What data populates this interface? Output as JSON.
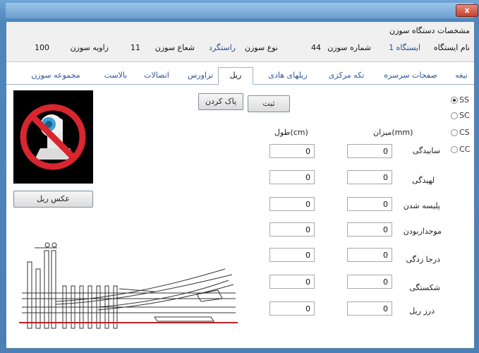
{
  "window": {
    "close_label": "x"
  },
  "info": {
    "header": "مشخصات دستگاه سوزن",
    "station_label": "نام ایستگاه",
    "station_value": "ایستگاه 1",
    "switch_number_label": "شماره سوزن",
    "switch_number_value": "44",
    "switch_type_label": "نوع سوزن",
    "switch_type_value": "راستگرد",
    "radius_label": "شعاع سوزن",
    "radius_value": "11",
    "angle_label": "زاویه سوزن",
    "angle_value": "100"
  },
  "tabs": [
    {
      "label": "تیغه"
    },
    {
      "label": "صفحات سرسره"
    },
    {
      "label": "تکه مرکزی"
    },
    {
      "label": "ریلهای هادی"
    },
    {
      "label": "ریل"
    },
    {
      "label": "تراورس"
    },
    {
      "label": "اتصالات"
    },
    {
      "label": "بالاست"
    },
    {
      "label": "مجموعه سوزن"
    }
  ],
  "active_tab": "ریل",
  "buttons": {
    "save": "ثبت",
    "clear": "پاک کردن",
    "rail_photo": "عکس ریل"
  },
  "radios": [
    {
      "label": "SS",
      "checked": true
    },
    {
      "label": "SC",
      "checked": false
    },
    {
      "label": "CS",
      "checked": false
    },
    {
      "label": "CC",
      "checked": false
    }
  ],
  "columns": {
    "amount": "میزان(mm)",
    "length": "طول(cm)"
  },
  "rows": [
    {
      "label": "سابیدگی",
      "amount": "0",
      "length": "0"
    },
    {
      "label": "لهیدگی",
      "amount": "0",
      "length": "0"
    },
    {
      "label": "پلیسه شدن",
      "amount": "0",
      "length": "0"
    },
    {
      "label": "موجداربودن",
      "amount": "0",
      "length": "0"
    },
    {
      "label": "درجا زدگی",
      "amount": "0",
      "length": "0"
    },
    {
      "label": "شکستگی",
      "amount": "0",
      "length": "0"
    },
    {
      "label": "درز ریل",
      "amount": "0",
      "length": "0"
    }
  ],
  "colors": {
    "accent": "#2b55a0",
    "diagram_highlight": "#c0202a"
  },
  "icons": {
    "photo": "no-camera-icon",
    "diagram": "switch-rail-diagram"
  }
}
